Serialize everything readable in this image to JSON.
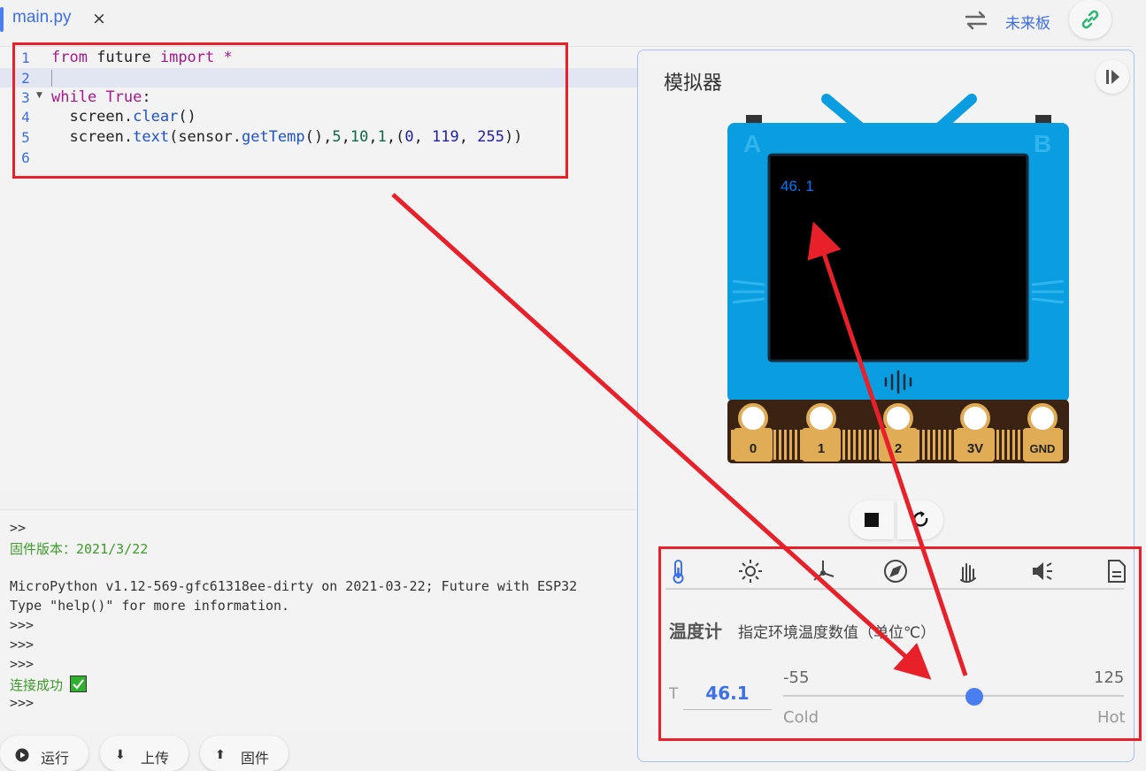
{
  "tab": {
    "filename": "main.py",
    "close": "×"
  },
  "header": {
    "board_name": "未来板"
  },
  "editor": {
    "line_numbers": [
      "1",
      "2",
      "3",
      "4",
      "5",
      "6"
    ],
    "lines": [
      {
        "kw1": "from",
        "mid": " future ",
        "kw2": "import",
        "rest": " *"
      },
      {},
      {
        "kw1": "while",
        "mid": " ",
        "kw2": "True",
        "rest": ":"
      },
      {
        "pre": "  screen.",
        "fn": "clear",
        "rest": "()"
      },
      {
        "pre": "  screen.",
        "fn": "text",
        "a": "(sensor.",
        "fn2": "getTemp",
        "b": "(),",
        "n1": "5",
        "c": ",",
        "n2": "10",
        "d": ",",
        "n3": "1",
        "e": ",(",
        "n4": "0",
        "f": ", ",
        "n5": "119",
        "g": ", ",
        "n6": "255",
        "h": "))"
      }
    ]
  },
  "console": {
    "lines": [
      ">>",
      "固件版本：2021/3/22",
      "",
      "MicroPython v1.12-569-gfc61318ee-dirty on 2021-03-22; Future with ESP32",
      "Type \"help()\" for more information.",
      ">>>",
      ">>>",
      ">>>",
      "连接成功",
      ">>>"
    ]
  },
  "buttons": {
    "run": "运行",
    "upload": "上传",
    "firmware": "固件"
  },
  "simulator": {
    "title": "模拟器",
    "screen_text": "46. 1",
    "screen_text_color": "#0077ff",
    "button_a": "A",
    "button_b": "B",
    "pins": [
      "0",
      "1",
      "2",
      "3V",
      "GND"
    ],
    "sensor_tabs": [
      "thermometer-icon",
      "light-icon",
      "accelerometer-icon",
      "compass-icon",
      "gesture-icon",
      "sound-icon",
      "file-icon"
    ],
    "sensor_name": "温度计",
    "sensor_desc": "指定环境温度数值（单位℃）",
    "t_label": "T",
    "t_value": "46.1",
    "min": "-55",
    "max": "125",
    "cold": "Cold",
    "hot": "Hot",
    "slider_value": 46.1,
    "slider_min": -55,
    "slider_max": 125
  },
  "colors": {
    "accent": "#3d6fe8",
    "annotation": "#e8202a",
    "device_body": "#0a9ee0",
    "pin_gold": "#e0ac55"
  }
}
